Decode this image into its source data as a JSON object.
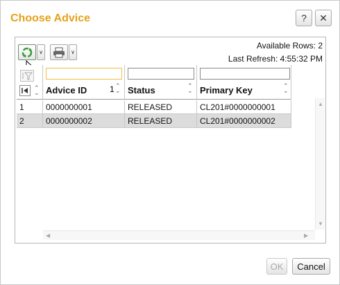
{
  "dialog": {
    "title": "Choose Advice",
    "help_label": "?",
    "close_label": "✕"
  },
  "toolbar": {
    "info": {
      "available_rows": "Available Rows: 2",
      "last_refresh": "Last Refresh: 4:55:32 PM"
    }
  },
  "grid": {
    "columns": [
      {
        "label": "",
        "filter_value": ""
      },
      {
        "label": "Advice ID",
        "sort_indicator": "1",
        "filter_value": ""
      },
      {
        "label": "Status",
        "filter_value": ""
      },
      {
        "label": "Primary Key",
        "filter_value": ""
      }
    ],
    "rows": [
      {
        "num": "1",
        "advice_id": "0000000001",
        "status": "RELEASED",
        "primary_key": "CL201#0000000001",
        "selected": false
      },
      {
        "num": "2",
        "advice_id": "0000000002",
        "status": "RELEASED",
        "primary_key": "CL201#0000000002",
        "selected": true
      }
    ]
  },
  "footer": {
    "ok_label": "OK",
    "cancel_label": "Cancel",
    "ok_enabled": false
  },
  "colors": {
    "title": "#e5a21a",
    "selected_row": "#dcdcdc",
    "active_filter_border": "#f0c040"
  },
  "icons": [
    "refresh-icon",
    "print-icon",
    "mouse-pointer-icon",
    "filter-icon",
    "first-page-icon"
  ]
}
